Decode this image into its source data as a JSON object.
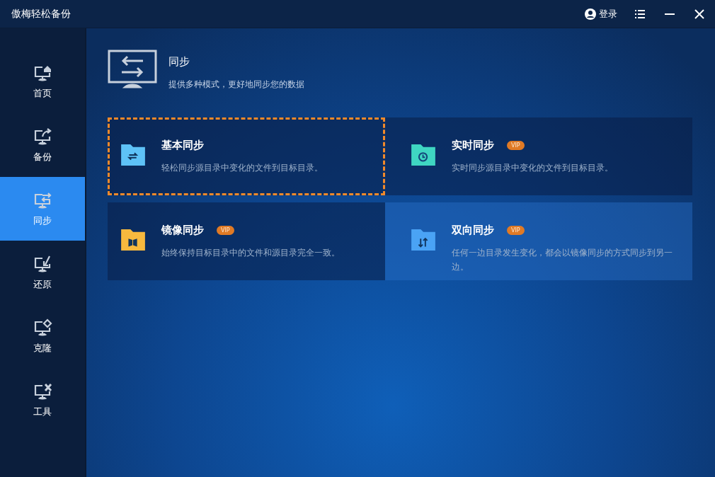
{
  "window": {
    "title": "傲梅轻松备份",
    "login": "登录"
  },
  "sidebar": {
    "items": [
      {
        "kind": "home",
        "label": "首页",
        "selected": false
      },
      {
        "kind": "backup",
        "label": "备份",
        "selected": false
      },
      {
        "kind": "sync",
        "label": "同步",
        "selected": true
      },
      {
        "kind": "restore",
        "label": "还原",
        "selected": false
      },
      {
        "kind": "clone",
        "label": "克隆",
        "selected": false
      },
      {
        "kind": "tools",
        "label": "工具",
        "selected": false
      }
    ]
  },
  "header": {
    "title": "同步",
    "subtitle": "提供多种模式，更好地同步您的数据"
  },
  "cards": [
    {
      "kind": "basic",
      "title": "基本同步",
      "description": "轻松同步源目录中变化的文件到目标目录。",
      "color": "#5ec2f7",
      "selected": true,
      "hovered": false
    },
    {
      "kind": "realtime",
      "title": "实时同步",
      "badge": "VIP",
      "description": "实时同步源目录中变化的文件到目标目录。",
      "color": "#3fd6c2",
      "selected": false,
      "hovered": false
    },
    {
      "kind": "mirror",
      "title": "镜像同步",
      "badge": "VIP",
      "description": "始终保持目标目录中的文件和源目录完全一致。",
      "color": "#f7b93e",
      "selected": false,
      "hovered": false
    },
    {
      "kind": "twoway",
      "title": "双向同步",
      "badge": "VIP",
      "description": "任何一边目录发生变化，都会以镜像同步的方式同步到另一边。",
      "color": "#4aa3f5",
      "selected": false,
      "hovered": true
    }
  ]
}
